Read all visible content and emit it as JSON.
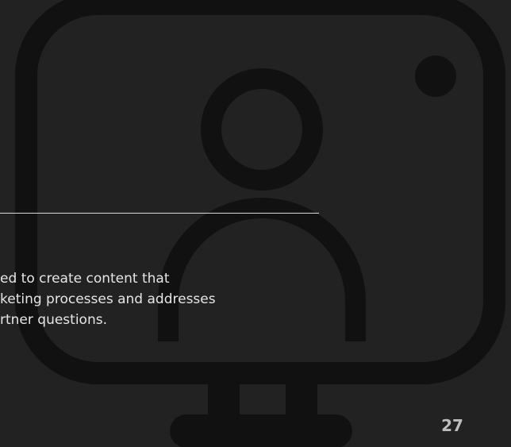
{
  "slide": {
    "body_lines": [
      "ed to create content that",
      "keting processes and addresses",
      "rtner questions."
    ],
    "page_number": "27"
  },
  "icons": {
    "background": "monitor-user-icon"
  },
  "colors": {
    "background": "#222222",
    "icon": "#111111",
    "text": "#e6e6e6",
    "divider": "#d8d8d8",
    "page_number": "#bdbdbd"
  }
}
